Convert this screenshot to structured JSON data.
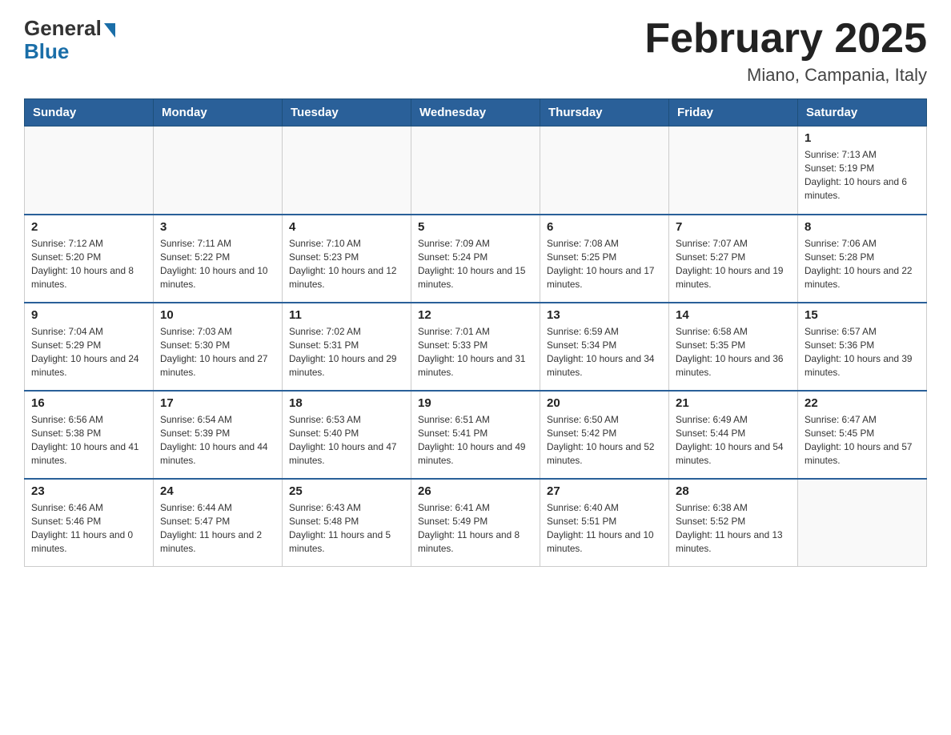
{
  "header": {
    "logo_general": "General",
    "logo_blue": "Blue",
    "title": "February 2025",
    "subtitle": "Miano, Campania, Italy"
  },
  "days_of_week": [
    "Sunday",
    "Monday",
    "Tuesday",
    "Wednesday",
    "Thursday",
    "Friday",
    "Saturday"
  ],
  "weeks": [
    [
      {
        "day": "",
        "info": ""
      },
      {
        "day": "",
        "info": ""
      },
      {
        "day": "",
        "info": ""
      },
      {
        "day": "",
        "info": ""
      },
      {
        "day": "",
        "info": ""
      },
      {
        "day": "",
        "info": ""
      },
      {
        "day": "1",
        "info": "Sunrise: 7:13 AM\nSunset: 5:19 PM\nDaylight: 10 hours and 6 minutes."
      }
    ],
    [
      {
        "day": "2",
        "info": "Sunrise: 7:12 AM\nSunset: 5:20 PM\nDaylight: 10 hours and 8 minutes."
      },
      {
        "day": "3",
        "info": "Sunrise: 7:11 AM\nSunset: 5:22 PM\nDaylight: 10 hours and 10 minutes."
      },
      {
        "day": "4",
        "info": "Sunrise: 7:10 AM\nSunset: 5:23 PM\nDaylight: 10 hours and 12 minutes."
      },
      {
        "day": "5",
        "info": "Sunrise: 7:09 AM\nSunset: 5:24 PM\nDaylight: 10 hours and 15 minutes."
      },
      {
        "day": "6",
        "info": "Sunrise: 7:08 AM\nSunset: 5:25 PM\nDaylight: 10 hours and 17 minutes."
      },
      {
        "day": "7",
        "info": "Sunrise: 7:07 AM\nSunset: 5:27 PM\nDaylight: 10 hours and 19 minutes."
      },
      {
        "day": "8",
        "info": "Sunrise: 7:06 AM\nSunset: 5:28 PM\nDaylight: 10 hours and 22 minutes."
      }
    ],
    [
      {
        "day": "9",
        "info": "Sunrise: 7:04 AM\nSunset: 5:29 PM\nDaylight: 10 hours and 24 minutes."
      },
      {
        "day": "10",
        "info": "Sunrise: 7:03 AM\nSunset: 5:30 PM\nDaylight: 10 hours and 27 minutes."
      },
      {
        "day": "11",
        "info": "Sunrise: 7:02 AM\nSunset: 5:31 PM\nDaylight: 10 hours and 29 minutes."
      },
      {
        "day": "12",
        "info": "Sunrise: 7:01 AM\nSunset: 5:33 PM\nDaylight: 10 hours and 31 minutes."
      },
      {
        "day": "13",
        "info": "Sunrise: 6:59 AM\nSunset: 5:34 PM\nDaylight: 10 hours and 34 minutes."
      },
      {
        "day": "14",
        "info": "Sunrise: 6:58 AM\nSunset: 5:35 PM\nDaylight: 10 hours and 36 minutes."
      },
      {
        "day": "15",
        "info": "Sunrise: 6:57 AM\nSunset: 5:36 PM\nDaylight: 10 hours and 39 minutes."
      }
    ],
    [
      {
        "day": "16",
        "info": "Sunrise: 6:56 AM\nSunset: 5:38 PM\nDaylight: 10 hours and 41 minutes."
      },
      {
        "day": "17",
        "info": "Sunrise: 6:54 AM\nSunset: 5:39 PM\nDaylight: 10 hours and 44 minutes."
      },
      {
        "day": "18",
        "info": "Sunrise: 6:53 AM\nSunset: 5:40 PM\nDaylight: 10 hours and 47 minutes."
      },
      {
        "day": "19",
        "info": "Sunrise: 6:51 AM\nSunset: 5:41 PM\nDaylight: 10 hours and 49 minutes."
      },
      {
        "day": "20",
        "info": "Sunrise: 6:50 AM\nSunset: 5:42 PM\nDaylight: 10 hours and 52 minutes."
      },
      {
        "day": "21",
        "info": "Sunrise: 6:49 AM\nSunset: 5:44 PM\nDaylight: 10 hours and 54 minutes."
      },
      {
        "day": "22",
        "info": "Sunrise: 6:47 AM\nSunset: 5:45 PM\nDaylight: 10 hours and 57 minutes."
      }
    ],
    [
      {
        "day": "23",
        "info": "Sunrise: 6:46 AM\nSunset: 5:46 PM\nDaylight: 11 hours and 0 minutes."
      },
      {
        "day": "24",
        "info": "Sunrise: 6:44 AM\nSunset: 5:47 PM\nDaylight: 11 hours and 2 minutes."
      },
      {
        "day": "25",
        "info": "Sunrise: 6:43 AM\nSunset: 5:48 PM\nDaylight: 11 hours and 5 minutes."
      },
      {
        "day": "26",
        "info": "Sunrise: 6:41 AM\nSunset: 5:49 PM\nDaylight: 11 hours and 8 minutes."
      },
      {
        "day": "27",
        "info": "Sunrise: 6:40 AM\nSunset: 5:51 PM\nDaylight: 11 hours and 10 minutes."
      },
      {
        "day": "28",
        "info": "Sunrise: 6:38 AM\nSunset: 5:52 PM\nDaylight: 11 hours and 13 minutes."
      },
      {
        "day": "",
        "info": ""
      }
    ]
  ]
}
